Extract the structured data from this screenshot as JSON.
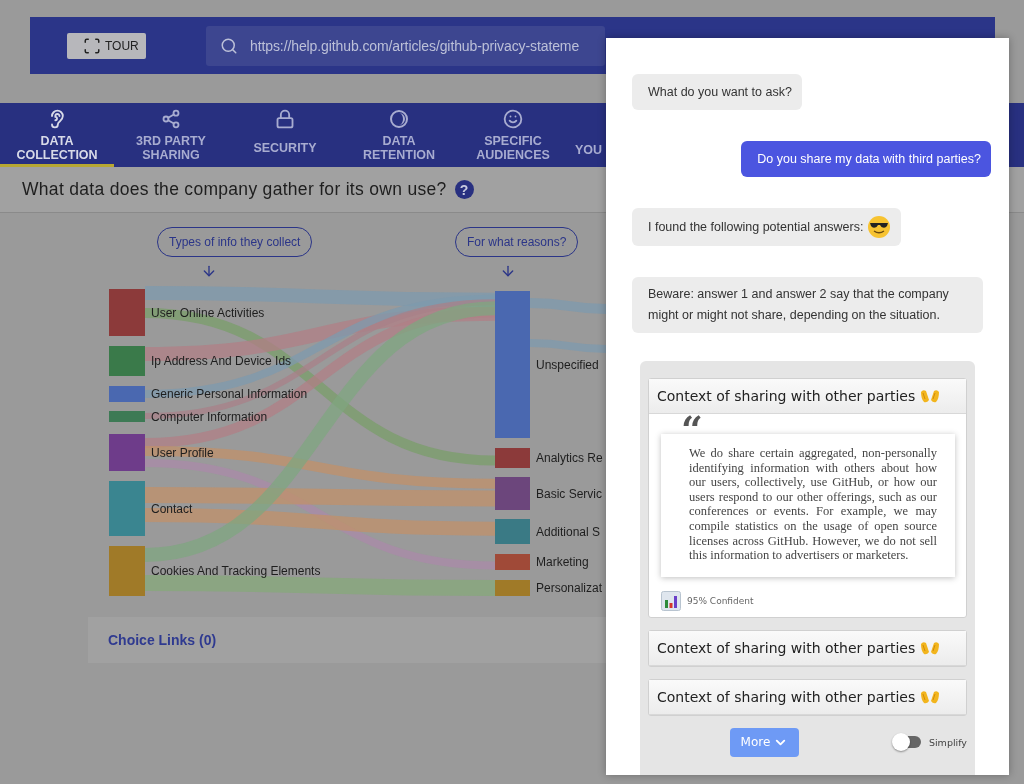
{
  "header": {
    "tour_button": "TOUR",
    "url": "https://help.github.com/articles/github-privacy-stateme"
  },
  "tabs": [
    {
      "label": "DATA COLLECTION",
      "selected": true
    },
    {
      "label": "3RD PARTY SHARING",
      "selected": false
    },
    {
      "label": "SECURITY",
      "selected": false
    },
    {
      "label": "DATA RETENTION",
      "selected": false
    },
    {
      "label": "SPECIFIC AUDIENCES",
      "selected": false
    },
    {
      "label": "YOU",
      "selected": false
    }
  ],
  "question": {
    "text": "What data does the company gather for its own use?",
    "help": "?"
  },
  "flow": {
    "left_heading": "Types of info they collect",
    "right_heading": "For what reasons?",
    "sources": [
      {
        "label": "User Online Activities",
        "color": "#8c3a3a"
      },
      {
        "label": "Ip Address And Device Ids",
        "color": "#3a7a4a"
      },
      {
        "label": "Generic Personal Information",
        "color": "#4a68b0"
      },
      {
        "label": "Computer Information",
        "color": "#3d7a55"
      },
      {
        "label": "User Profile",
        "color": "#6e3c8a"
      },
      {
        "label": "Contact",
        "color": "#3a8590"
      },
      {
        "label": "Cookies And Tracking Elements",
        "color": "#a07a28"
      }
    ],
    "purposes": [
      {
        "label": "Unspecified",
        "color": "#4a68b0"
      },
      {
        "label": "Analytics Re",
        "color": "#8c3a3a"
      },
      {
        "label": "Basic Servic",
        "color": "#6c467c"
      },
      {
        "label": "Additional S",
        "color": "#3a7a85"
      },
      {
        "label": "Marketing",
        "color": "#a04a38"
      },
      {
        "label": "Personalizat",
        "color": "#a07a28"
      }
    ]
  },
  "choice_links": "Choice Links (0)",
  "chat": {
    "messages": [
      {
        "kind": "bot",
        "text": "What do you want to ask?"
      },
      {
        "kind": "user",
        "text": "Do you share my data with third parties?"
      },
      {
        "kind": "bot_emoji",
        "text": "I found the following potential answers:"
      },
      {
        "kind": "bot",
        "text": "Beware: answer 1 and answer 2 say that the company might or might not share, depending on the situation."
      }
    ],
    "answers": [
      {
        "title": "Context of sharing with other parties",
        "expanded": true,
        "quote_mark": "“",
        "quote": "We do share certain aggregated, non-personally identifying information with others about how our users, collectively, use GitHub, or how our users respond to our other offerings, such as our conferences or events. For example, we may compile statistics on the usage of open source licenses across GitHub. However, we do not sell this information to advertisers or marketers.",
        "confidence": "95% Confident"
      },
      {
        "title": "Context of sharing with other parties",
        "expanded": false
      },
      {
        "title": "Context of sharing with other parties",
        "expanded": false
      }
    ],
    "more_button": "More",
    "toggle": {
      "label": "Simplify",
      "on": false
    }
  }
}
